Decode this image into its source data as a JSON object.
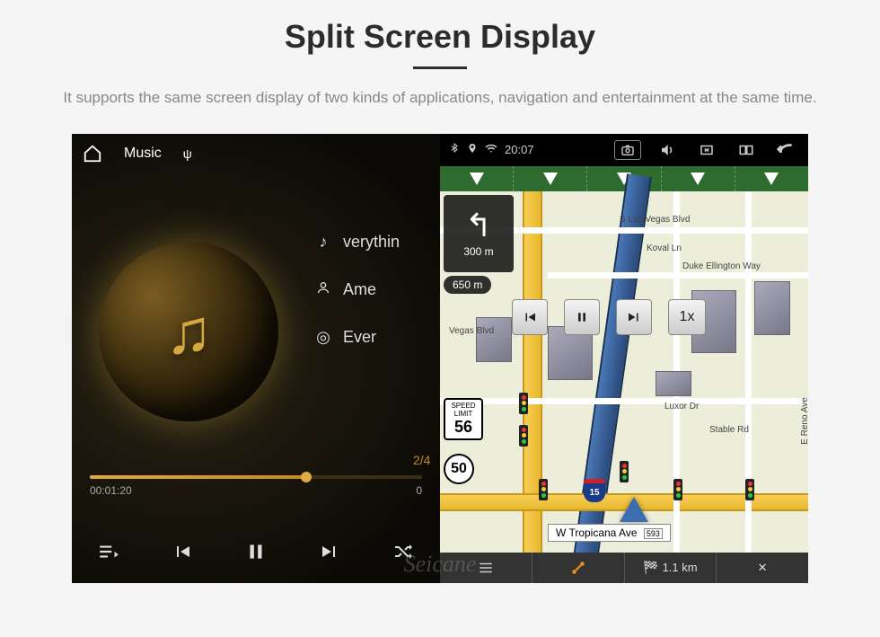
{
  "header": {
    "title": "Split Screen Display",
    "subtitle": "It supports the same screen display of two kinds of applications, navigation and entertainment at the same time."
  },
  "statusbar": {
    "time": "20:07"
  },
  "music": {
    "app_label": "Music",
    "title": "verythin",
    "artist": "Ame",
    "album": "Ever",
    "track_counter": "2/4",
    "elapsed": "00:01:20",
    "total": "0"
  },
  "nav": {
    "turn_distance": "300 m",
    "next_distance": "650 m",
    "speed_limit_caption": "SPEED LIMIT",
    "speed_limit": "56",
    "route_number": "50",
    "interstate": "15",
    "sim_speed": "1x",
    "current_street": "W Tropicana Ave",
    "current_street_tag": "593",
    "streets": {
      "s_las_vegas": "S Las Vegas Blvd",
      "koval": "Koval Ln",
      "duke": "Duke Ellington Way",
      "vegas_blvd": "Vegas Blvd",
      "luxor": "Luxor Dr",
      "stable": "Stable Rd",
      "reno": "E Reno Ave"
    },
    "bottom": {
      "eta": "1.1 km",
      "close": "✕"
    }
  },
  "watermark": "Seicane"
}
